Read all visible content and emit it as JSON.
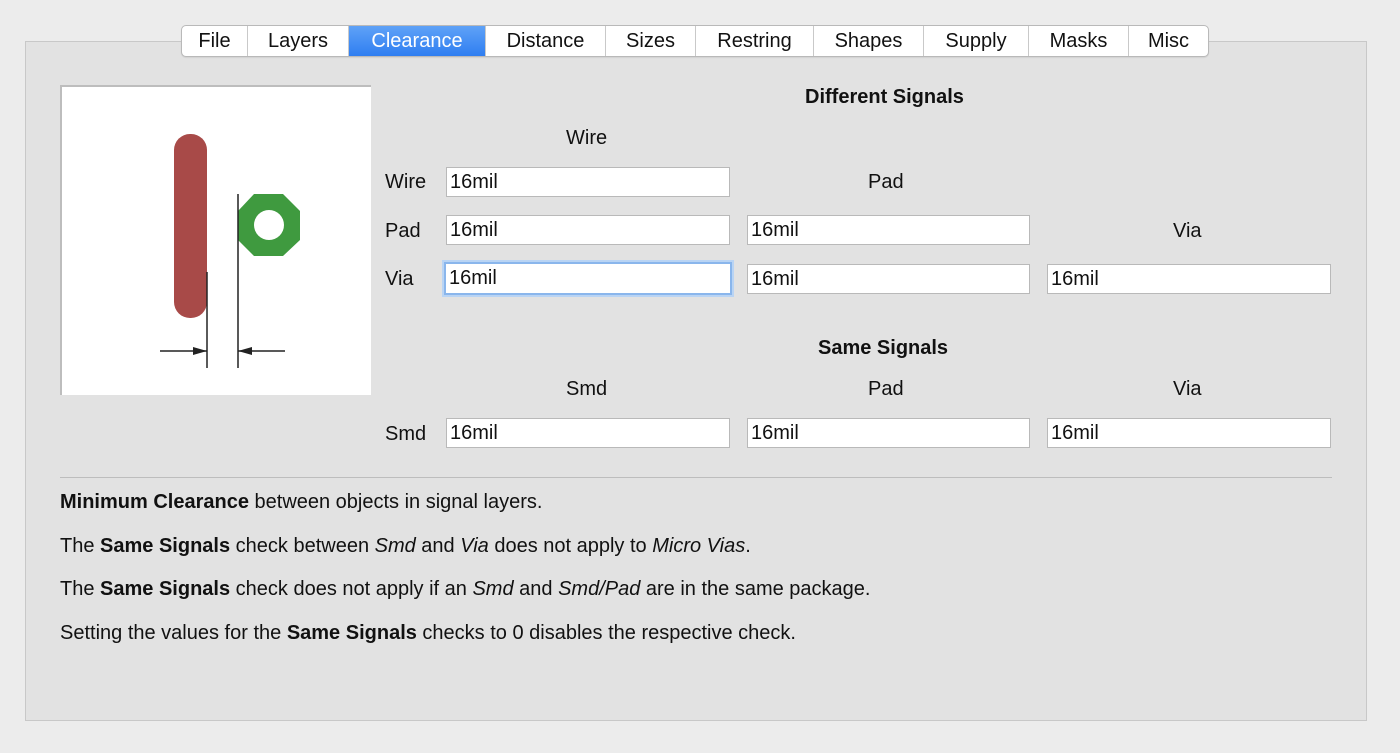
{
  "tabs": [
    {
      "label": "File"
    },
    {
      "label": "Layers"
    },
    {
      "label": "Clearance"
    },
    {
      "label": "Distance"
    },
    {
      "label": "Sizes"
    },
    {
      "label": "Restring"
    },
    {
      "label": "Shapes"
    },
    {
      "label": "Supply"
    },
    {
      "label": "Masks"
    },
    {
      "label": "Misc"
    }
  ],
  "active_tab": "Clearance",
  "different_signals": {
    "heading": "Different Signals",
    "col_wire": "Wire",
    "col_pad": "Pad",
    "col_via": "Via",
    "row_wire": "Wire",
    "row_pad": "Pad",
    "row_via": "Via",
    "wire_wire": "16mil",
    "pad_wire": "16mil",
    "pad_pad": "16mil",
    "via_wire": "16mil",
    "via_pad": "16mil",
    "via_via": "16mil"
  },
  "same_signals": {
    "heading": "Same Signals",
    "col_smd": "Smd",
    "col_pad": "Pad",
    "col_via": "Via",
    "row_smd": "Smd",
    "smd_smd": "16mil",
    "smd_pad": "16mil",
    "smd_via": "16mil"
  },
  "notes": {
    "n1_bold": "Minimum Clearance",
    "n1_rest": " between objects in signal layers.",
    "n2_a": "The ",
    "n2_bold": "Same Signals",
    "n2_b": " check between ",
    "n2_i1": "Smd",
    "n2_c": " and ",
    "n2_i2": "Via",
    "n2_d": " does not apply to ",
    "n2_i3": "Micro Vias",
    "n2_e": ".",
    "n3_a": "The ",
    "n3_bold": "Same Signals",
    "n3_b": " check does not apply if an ",
    "n3_i1": "Smd",
    "n3_c": " and ",
    "n3_i2": "Smd/Pad",
    "n3_d": " are in the same package.",
    "n4_a": "Setting the values for the ",
    "n4_bold": "Same Signals",
    "n4_b": " checks to 0 disables the respective check."
  },
  "colors": {
    "accent": "#2f7ef1",
    "wire": "#a84a48",
    "pad": "#3f9a3f"
  }
}
